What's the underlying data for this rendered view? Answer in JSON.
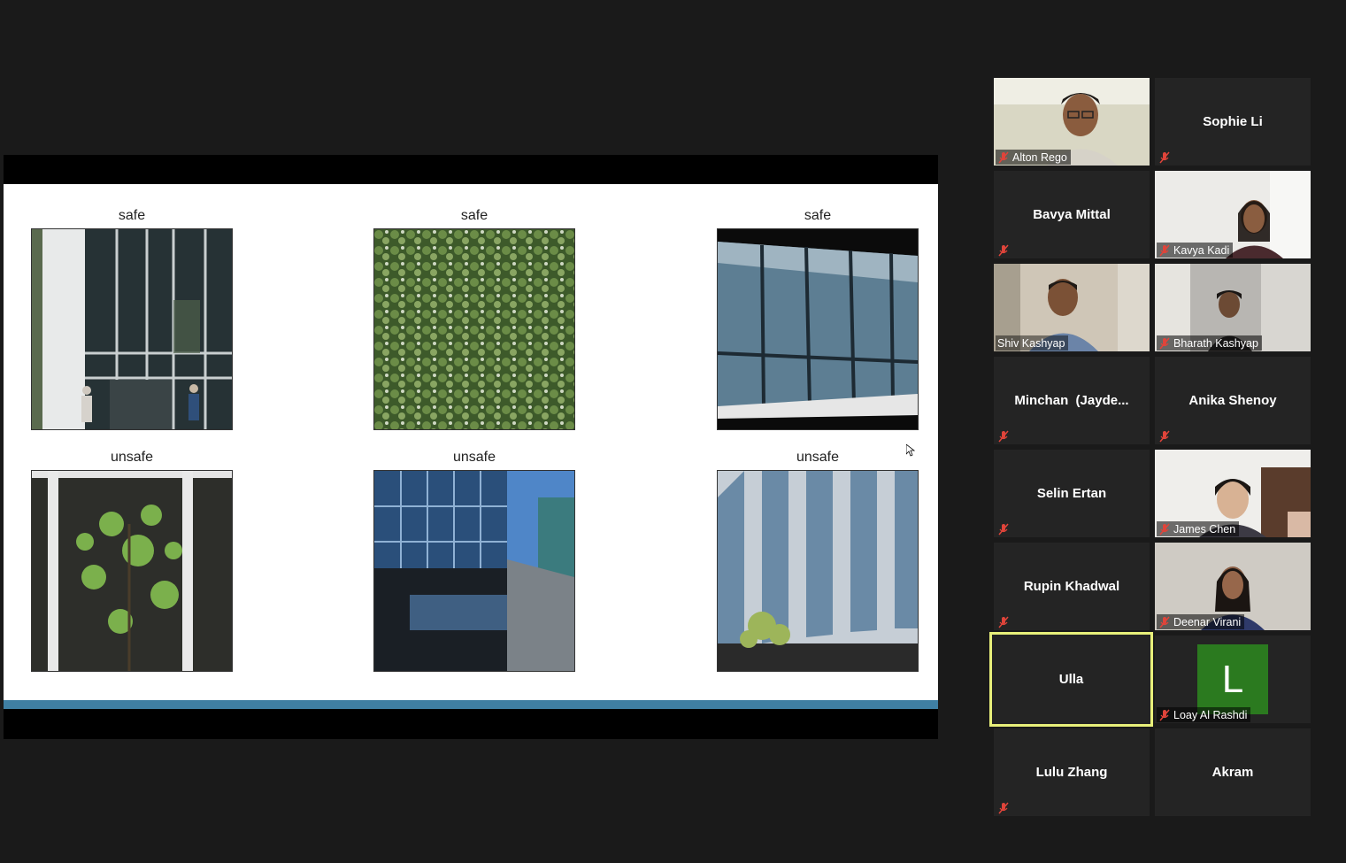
{
  "slide": {
    "top_labels": [
      "safe",
      "safe",
      "safe"
    ],
    "bottom_labels": [
      "unsafe",
      "unsafe",
      "unsafe"
    ]
  },
  "participants": [
    {
      "name": "Alton Rego",
      "video": true,
      "muted": true
    },
    {
      "name": "Sophie Li",
      "video": false,
      "muted": true
    },
    {
      "name": "Bavya Mittal",
      "video": false,
      "muted": true
    },
    {
      "name": "Kavya Kadi",
      "video": true,
      "muted": true
    },
    {
      "name": "Shiv Kashyap",
      "video": true,
      "muted": false
    },
    {
      "name": "Bharath Kashyap",
      "video": true,
      "muted": true
    },
    {
      "name": "Minchan  (Jayde...",
      "video": false,
      "muted": true
    },
    {
      "name": "Anika Shenoy",
      "video": false,
      "muted": true
    },
    {
      "name": "Selin Ertan",
      "video": false,
      "muted": true
    },
    {
      "name": "James Chen",
      "video": true,
      "muted": true
    },
    {
      "name": "Rupin Khadwal",
      "video": false,
      "muted": true
    },
    {
      "name": "Deenar Virani",
      "video": true,
      "muted": true
    },
    {
      "name": "Ulla",
      "video": false,
      "muted": false,
      "active_speaker": true
    },
    {
      "name": "Loay Al Rashdi",
      "video": false,
      "muted": true,
      "avatar_letter": "L"
    },
    {
      "name": "Lulu Zhang",
      "video": false,
      "muted": true
    },
    {
      "name": "Akram",
      "video": false,
      "muted": false
    }
  ],
  "colors": {
    "background": "#1a1a1a",
    "tile": "#242424",
    "active_speaker_border": "#e8f07a",
    "muted_icon": "#e0443a",
    "avatar_bg": "#2b7a1f",
    "slide_accent": "#3f7fa3"
  }
}
